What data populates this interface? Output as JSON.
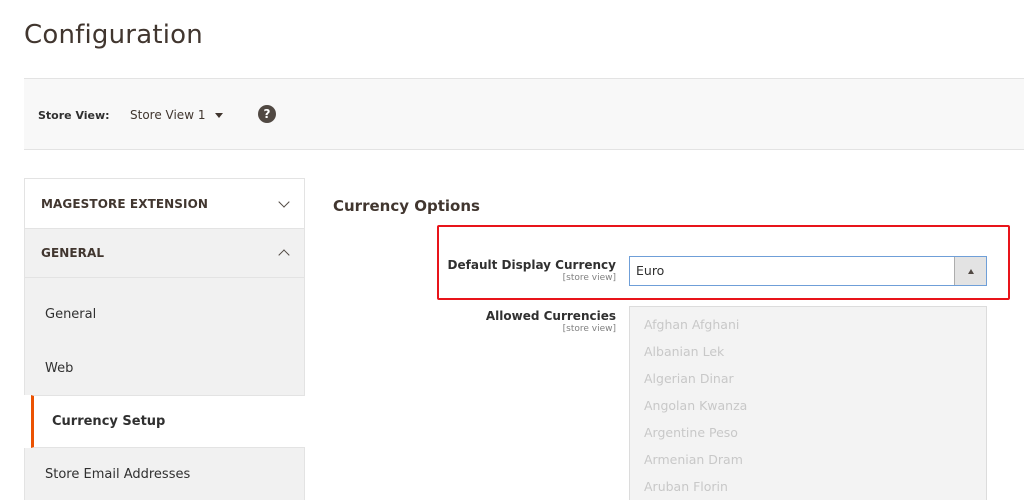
{
  "page": {
    "title": "Configuration"
  },
  "scope": {
    "label": "Store View:",
    "selected": "Store View 1",
    "help_icon": "question-circle-icon"
  },
  "sidebar": {
    "sections": [
      {
        "title": "MAGESTORE EXTENSION",
        "state": "collapsed",
        "icon": "chevron-down-icon"
      },
      {
        "title": "GENERAL",
        "state": "expanded",
        "icon": "chevron-up-icon",
        "items": [
          {
            "label": "General",
            "active": false
          },
          {
            "label": "Web",
            "active": false
          },
          {
            "label": "Currency Setup",
            "active": true
          },
          {
            "label": "Store Email Addresses",
            "active": false
          }
        ]
      }
    ]
  },
  "main": {
    "group_title": "Currency Options",
    "fields": {
      "default_display_currency": {
        "label": "Default Display Currency",
        "scope": "[store view]",
        "value": "Euro"
      },
      "allowed_currencies": {
        "label": "Allowed Currencies",
        "scope": "[store view]",
        "options": [
          "Afghan Afghani",
          "Albanian Lek",
          "Algerian Dinar",
          "Angolan Kwanza",
          "Argentine Peso",
          "Armenian Dram",
          "Aruban Florin"
        ]
      }
    }
  },
  "colors": {
    "accent_active": "#eb5202",
    "highlight_annotation": "#e8141a",
    "select_focus_border": "#6f9fd8"
  }
}
